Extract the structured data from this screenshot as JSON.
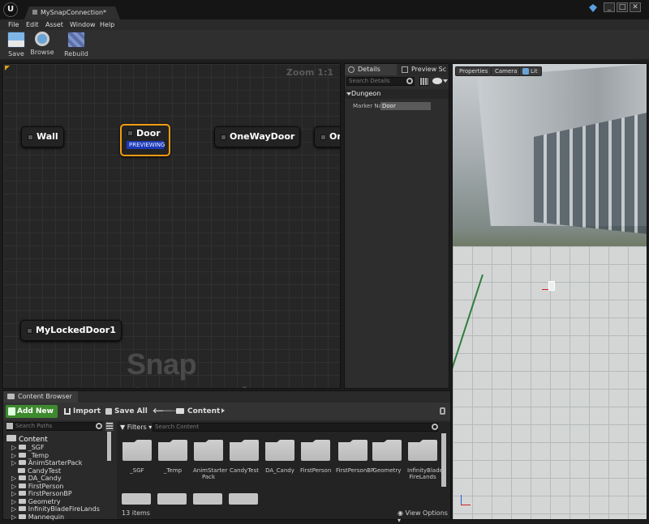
{
  "titlebar": {
    "tab_title": "MySnapConnection*"
  },
  "menu": {
    "items": [
      "File",
      "Edit",
      "Asset",
      "Window",
      "Help"
    ]
  },
  "toolbar": {
    "save": "Save",
    "browse": "Browse",
    "rebuild": "Rebuild"
  },
  "graph": {
    "zoom": "Zoom 1:1",
    "watermark": "Snap Connection",
    "nodes": {
      "wall": "Wall",
      "door": "Door",
      "door_badge": "PREVIEWING",
      "oneway": "OneWayDoor",
      "partial": "On",
      "locked": "MyLockedDoor1"
    }
  },
  "details": {
    "tab_details": "Details",
    "tab_preview": "Preview Sc",
    "search_placeholder": "Search Details",
    "category": "Dungeon",
    "marker_label": "Marker Na",
    "marker_value": "Door"
  },
  "viewport": {
    "properties": "Properties",
    "camera": "Camera",
    "lit": "Lit"
  },
  "content_browser": {
    "tab": "Content Browser",
    "add_new": "Add New",
    "import": "Import",
    "save_all": "Save All",
    "path": "Content",
    "search_paths": "Search Paths",
    "filters": "Filters",
    "search_content": "Search Content",
    "tree_root": "Content",
    "tree": [
      "_SGF",
      "_Temp",
      "AnimStarterPack",
      "CandyTest",
      "DA_Candy",
      "FirstPerson",
      "FirstPersonBP",
      "Geometry",
      "InfinityBladeFireLands",
      "Mannequin"
    ],
    "assets": [
      "_SGF",
      "_Temp",
      "AnimStarter Pack",
      "CandyTest",
      "DA_Candy",
      "FirstPerson",
      "FirstPersonBP",
      "Geometry",
      "InfinityBlade FireLands"
    ],
    "items_count": "13 items",
    "view_options": "View Options"
  }
}
